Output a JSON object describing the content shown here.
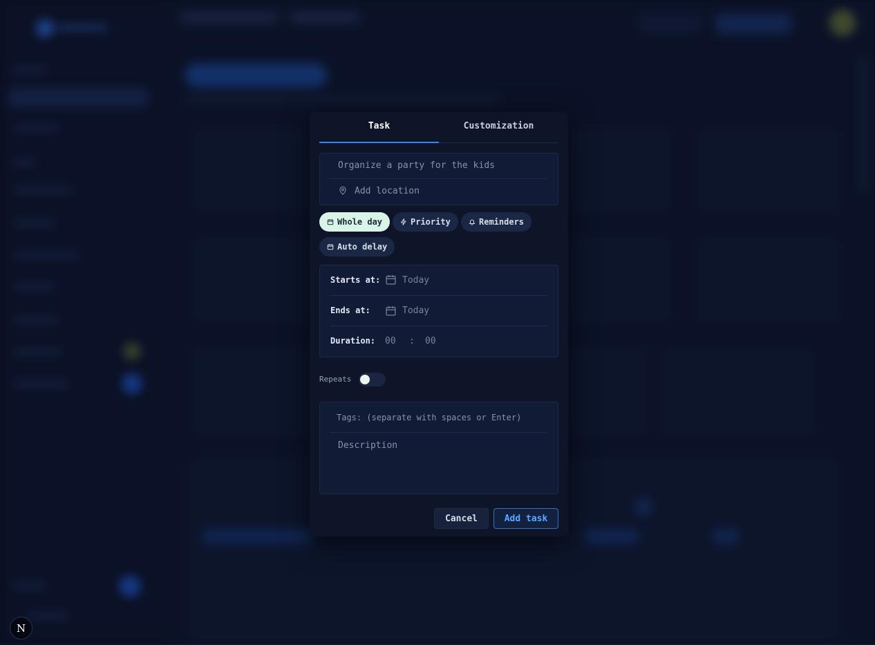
{
  "modal": {
    "tabs": [
      {
        "label": "Task",
        "active": true
      },
      {
        "label": "Customization",
        "active": false
      }
    ],
    "title_placeholder": "Organize a party for the kids",
    "location_placeholder": "Add location",
    "chips": [
      {
        "label": "Whole day",
        "icon": "calendar-icon",
        "selected": true
      },
      {
        "label": "Priority",
        "icon": "bolt-icon",
        "selected": false
      },
      {
        "label": "Reminders",
        "icon": "bell-icon",
        "selected": false
      },
      {
        "label": "Auto delay",
        "icon": "calendar-icon",
        "selected": false
      }
    ],
    "starts_at": {
      "label": "Starts at:",
      "value": "Today"
    },
    "ends_at": {
      "label": "Ends at:",
      "value": "Today"
    },
    "duration": {
      "label": "Duration:",
      "hours": "00",
      "separator": ":",
      "minutes": "00"
    },
    "repeats": {
      "label": "Repeats",
      "on": false
    },
    "tags_placeholder": "Tags: (separate with spaces or Enter)",
    "description_placeholder": "Description",
    "cancel_label": "Cancel",
    "add_label": "Add task"
  },
  "dev_badge": {
    "label": "N"
  },
  "colors": {
    "accent": "#3b82f6",
    "chip_selected_bg": "#d8f5e7",
    "modal_bg": "#0e1528",
    "add_text": "#5aa8ff"
  }
}
